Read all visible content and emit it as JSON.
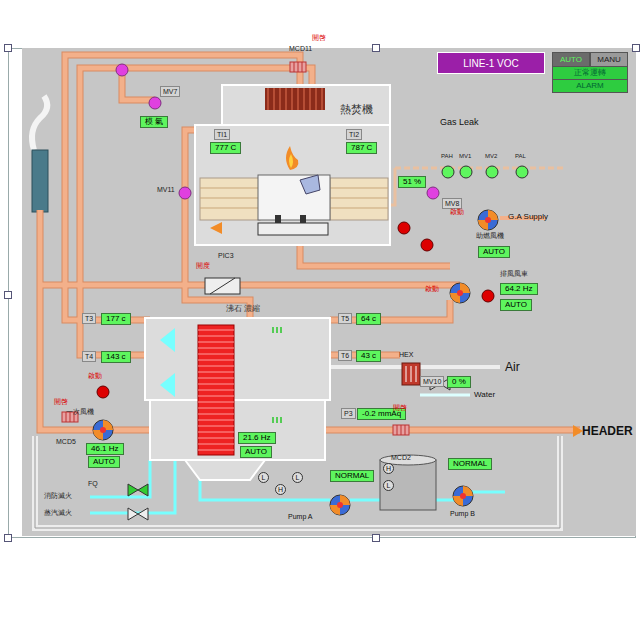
{
  "title": "LINE-1 VOC",
  "mode_buttons": [
    {
      "label": "AUTO",
      "selected": true
    },
    {
      "label": "MANU",
      "selected": false
    }
  ],
  "status_lamps": [
    {
      "label": "正常運轉",
      "color": "#2ecc40"
    },
    {
      "label": "ALARM",
      "color": "#2ecc40"
    }
  ],
  "incinerator": {
    "name": "熱焚機"
  },
  "readouts": [
    {
      "tag": "TI1",
      "value": "777 C"
    },
    {
      "tag": "TI2",
      "value": "787 C"
    },
    {
      "tag": "T3",
      "value": "177 c"
    },
    {
      "tag": "T4",
      "value": "143 c"
    },
    {
      "tag": "T5",
      "value": "64 c"
    },
    {
      "tag": "T6",
      "value": "43 c"
    },
    {
      "tag": "P3",
      "value": "-0.2 mmAq"
    },
    {
      "tag": "MV8",
      "value": "51 %"
    },
    {
      "tag": "MV10",
      "value": "0 %"
    },
    {
      "tag": "MV7",
      "value": "模 氣"
    }
  ],
  "dampers": [
    {
      "tag": "MCD11",
      "state": "開啓"
    },
    {
      "tag": "MCD5",
      "state": "開啓"
    },
    {
      "tag": "MCD2",
      "state": "開啓"
    }
  ],
  "valves": [
    {
      "tag": "MV11"
    },
    {
      "tag": "PIC3",
      "state": "開度"
    }
  ],
  "fans": [
    {
      "name": "助燃風機",
      "state": "啟動",
      "speed": "",
      "mode": "AUTO"
    },
    {
      "name": "排風風車",
      "state": "啟動",
      "speed": "64.2 Hz",
      "mode": "AUTO"
    },
    {
      "name": "一次風機",
      "state": "啟動",
      "speed": "46.1 Hz",
      "mode": "AUTO"
    }
  ],
  "rotor": {
    "name": "沸石 濃縮",
    "speed": "21.6 Hz",
    "mode": "AUTO"
  },
  "gas_train": {
    "label": "Gas Leak",
    "instruments": [
      "PAH",
      "MV1",
      "MV2",
      "PAL"
    ],
    "supply": "G.A Supply"
  },
  "labels": {
    "air": "Air",
    "water": "Water",
    "header": "HEADER",
    "hex": "HEX",
    "flow": "FQ",
    "fire_line": "消防滅火",
    "steam_line": "蒸汽滅火"
  },
  "tank_switches": [
    "H",
    "L"
  ],
  "sump_switches": [
    "L",
    "H",
    "L"
  ],
  "pumps": [
    {
      "name": "Pump A",
      "status": "NORMAL"
    },
    {
      "name": "Pump B",
      "status": "NORMAL"
    }
  ],
  "alarm_lamps": [
    {
      "on": true,
      "color": "#dd0000"
    },
    {
      "on": true,
      "color": "#dd0000"
    },
    {
      "on": true,
      "color": "#dd0000"
    },
    {
      "on": true,
      "color": "#dd0000"
    }
  ]
}
